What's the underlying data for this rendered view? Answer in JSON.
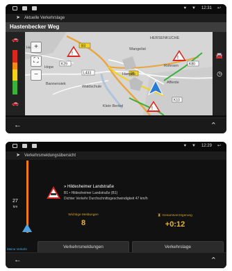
{
  "screen1": {
    "status": {
      "time": "12:31"
    },
    "title": "Aktuelle Verkehrslage",
    "street": "Hastenbecker Weg",
    "map_labels": {
      "town_hessisch": "Hessisch",
      "hope": "Hope",
      "bannensiek": "Bannensiek",
      "waldschule": "Waldschule",
      "hamelin": "Hameln",
      "affelde": "Afferde",
      "rohrsen": "Rohrsen",
      "hersenkuche": "HERSENKUCHE",
      "wangelist": "Wangelist",
      "klein_berkel": "Klein Berkel"
    },
    "road_numbers": [
      "B3",
      "K29",
      "L433",
      "K80",
      "K10",
      "B1"
    ]
  },
  "screen2": {
    "status": {
      "time": "12:29"
    },
    "title": "Verkehrsmeldungsübersicht",
    "distance": "27",
    "distance_unit": "km",
    "timeline_label": "Meine Verkehr",
    "event": {
      "title": "» Hildesheimer Landstraße",
      "road": "B1 • Hildesheimer Landstraße (B1)",
      "description": "Dichter Verkehr Durchschnittsgeschwindigkeit 47 km/h"
    },
    "stats": {
      "messages_label": "Wichtige Meldungen",
      "messages_value": "8",
      "delay_label": "Gesamtverzögerung",
      "delay_value": "+0:12"
    },
    "buttons": {
      "messages": "Verkehrsmeldungen",
      "situation": "Verkehrslage"
    }
  }
}
